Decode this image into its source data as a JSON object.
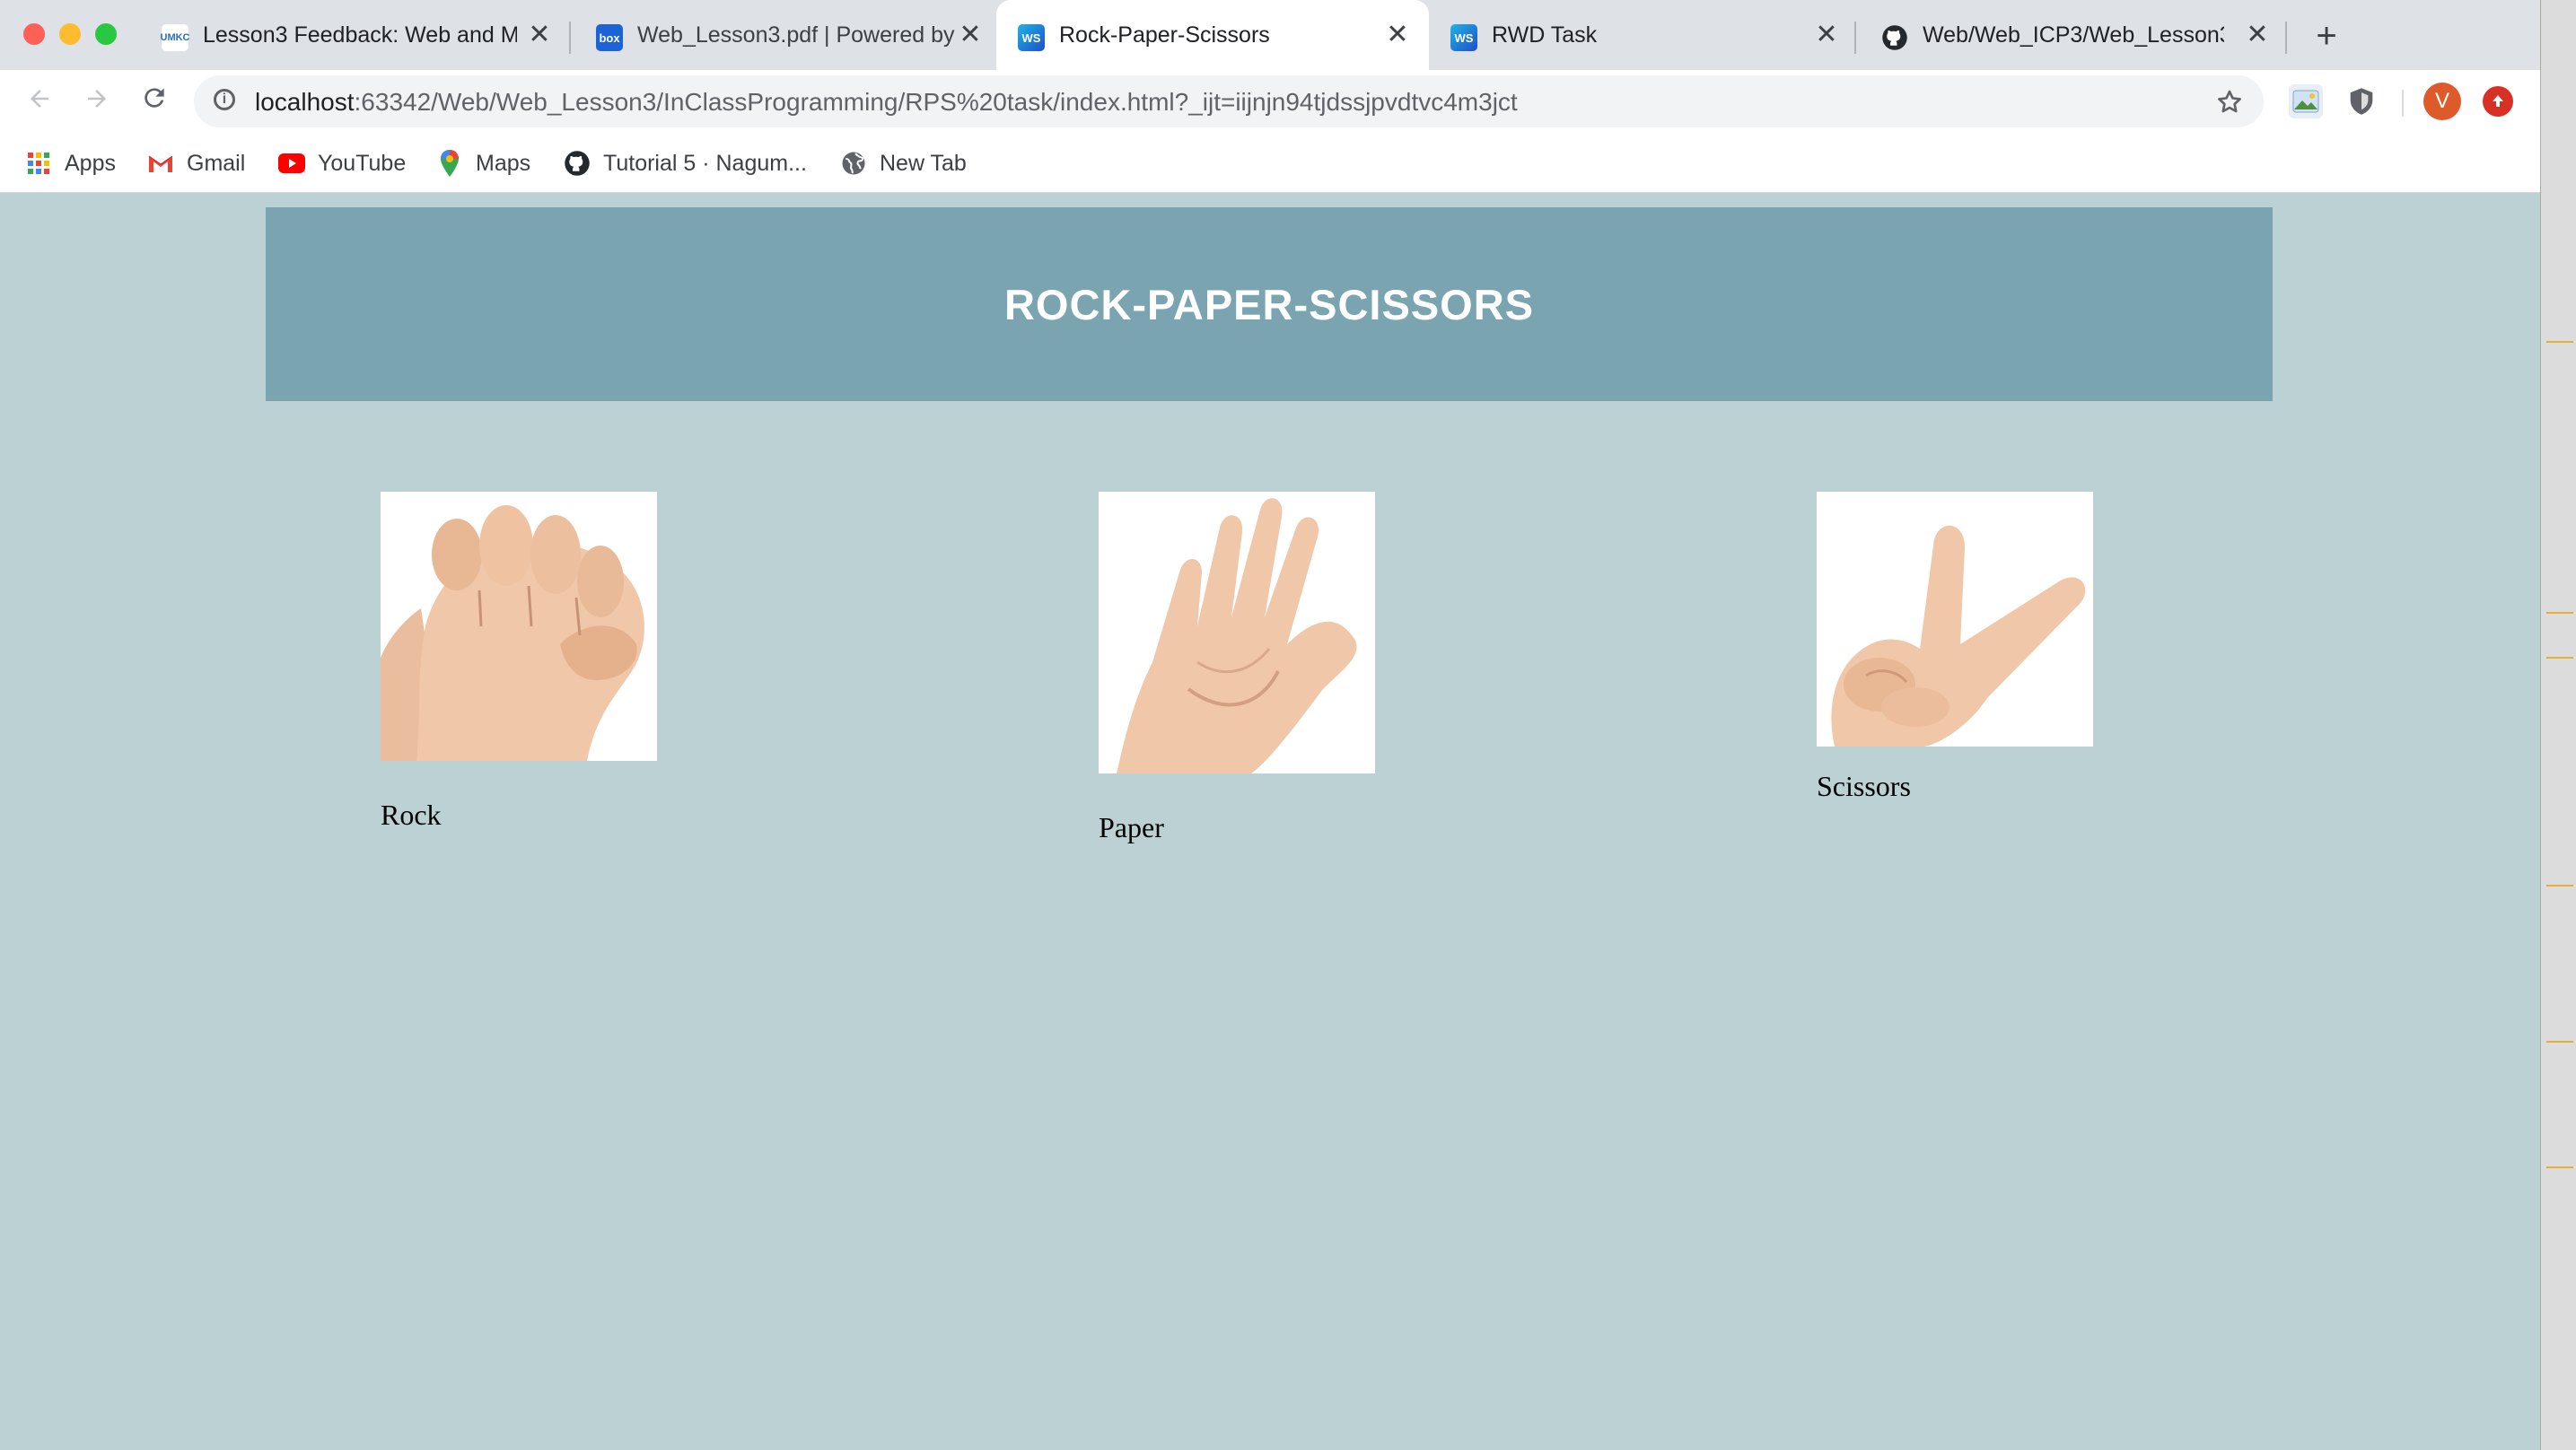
{
  "browser": {
    "tabs": [
      {
        "title": "Lesson3 Feedback: Web and M",
        "favicon": "umkc-icon",
        "active": false
      },
      {
        "title": "Web_Lesson3.pdf | Powered by",
        "favicon": "box-icon",
        "active": false
      },
      {
        "title": "Rock-Paper-Scissors",
        "favicon": "webstorm-icon",
        "active": true
      },
      {
        "title": "RWD Task",
        "favicon": "webstorm-icon",
        "active": false
      },
      {
        "title": "Web/Web_ICP3/Web_Lesson3",
        "favicon": "github-icon",
        "active": false
      }
    ],
    "favicon_text": {
      "umkc": "UMKC",
      "box": "box",
      "webstorm": "WS"
    },
    "new_tab_glyph": "+",
    "close_glyph": "✕",
    "url_host": "localhost",
    "url_rest": ":63342/Web/Web_Lesson3/InClassProgramming/RPS%20task/index.html?_ijt=iijnjn94tjdssjpvdtvc4m3jct",
    "profile_initial": "V",
    "bookmarks": [
      {
        "label": "Apps",
        "icon": "apps-grid-icon"
      },
      {
        "label": "Gmail",
        "icon": "gmail-icon"
      },
      {
        "label": "YouTube",
        "icon": "youtube-icon"
      },
      {
        "label": "Maps",
        "icon": "maps-pin-icon"
      },
      {
        "label": "Tutorial 5 · Nagum...",
        "icon": "github-icon"
      },
      {
        "label": "New Tab",
        "icon": "globe-icon"
      }
    ]
  },
  "page": {
    "heading": "ROCK-PAPER-SCISSORS",
    "choices": [
      {
        "label": "Rock",
        "image": "fist-hand-icon"
      },
      {
        "label": "Paper",
        "image": "open-palm-hand-icon"
      },
      {
        "label": "Scissors",
        "image": "v-sign-hand-icon"
      }
    ]
  },
  "colors": {
    "page_background": "#bcd1d3",
    "banner_background": "#7aa5b0",
    "heading_text": "#ffffff",
    "avatar": "#dd5a2b",
    "update_badge": "#d93025"
  }
}
